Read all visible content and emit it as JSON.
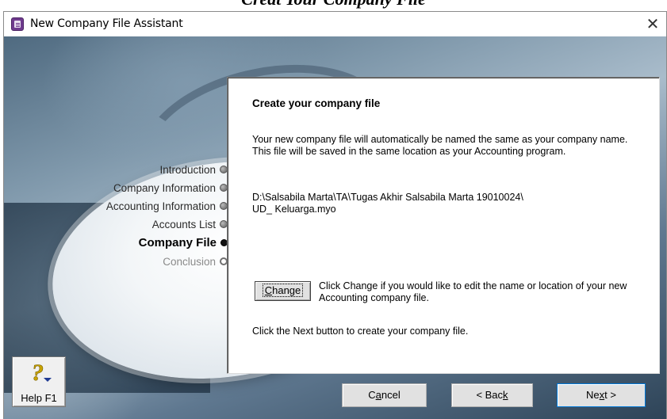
{
  "document": {
    "caption": "Creat Your Company File"
  },
  "window": {
    "title": "New Company File Assistant",
    "close_symbol": "✕",
    "app_icon": "company-file-icon"
  },
  "steps": [
    {
      "label": "Introduction",
      "state": "done"
    },
    {
      "label": "Company Information",
      "state": "done"
    },
    {
      "label": "Accounting Information",
      "state": "done"
    },
    {
      "label": "Accounts List",
      "state": "done"
    },
    {
      "label": "Company File",
      "state": "current"
    },
    {
      "label": "Conclusion",
      "state": "upcoming"
    }
  ],
  "panel": {
    "heading": "Create your company file",
    "description": "Your new company file will automatically be named the same as your company name.  This file will be saved in the same location as your Accounting program.",
    "path_line1": "D:\\Salsabila Marta\\TA\\Tugas Akhir Salsabila Marta 19010024\\",
    "path_line2": "UD_ Keluarga.myo",
    "change_button": "Change",
    "change_button_mnemonic": "C",
    "change_button_rest": "hange",
    "change_help": "Click Change if you would like to edit the name or location of your new Accounting company file.",
    "next_hint": "Click the Next button to create your company file."
  },
  "help": {
    "label": "Help F1",
    "icon": "help-question-icon"
  },
  "buttons": {
    "cancel": {
      "label": "Cancel",
      "pre": "C",
      "mnemonic": "a",
      "post": "ncel"
    },
    "back": {
      "label": "< Back",
      "pre": "< Bac",
      "mnemonic": "k",
      "post": ""
    },
    "next": {
      "label": "Next >",
      "pre": "Ne",
      "mnemonic": "x",
      "post": "t >"
    }
  },
  "colors": {
    "focus_border": "#0078d7",
    "current_step_dot": "#111111",
    "window_background": "#f0f0f0"
  }
}
